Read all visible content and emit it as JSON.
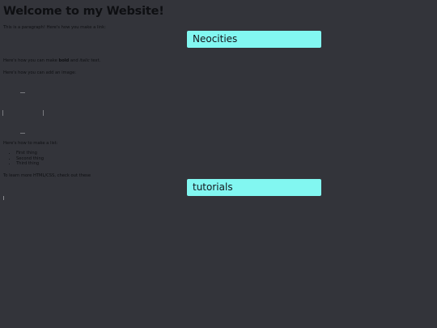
{
  "page": {
    "title": "Welcome to my Website!",
    "intro": "This is a paragraph! Here's how you make a link:",
    "link1": "Neocities",
    "bold_prefix": "Here's how you can make ",
    "bold_word": "bold",
    "bold_mid": " and ",
    "italic_word": "italic",
    "bold_suffix": " text.",
    "image_text": "Here's how you can add an image:",
    "list_intro": "Here's how to make a list:",
    "list_items": [
      "First thing",
      "Second thing",
      "Third thing"
    ],
    "learn_more": "To learn more HTML/CSS, check out these",
    "link2": "tutorials"
  },
  "colors": {
    "background": "#33343a",
    "text": "#0e0f12",
    "link_bg": "#82f7f1"
  }
}
